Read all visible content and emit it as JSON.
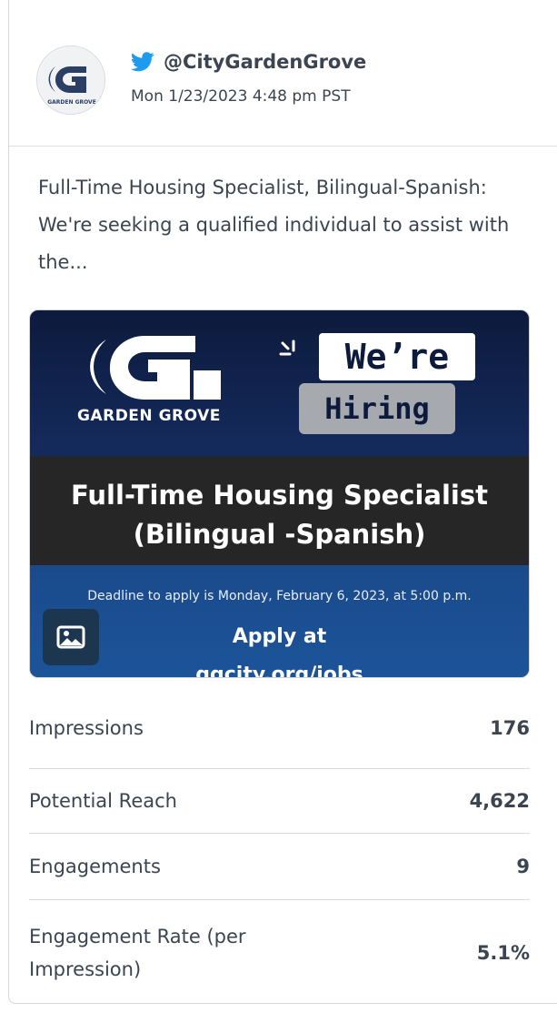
{
  "post": {
    "network_icon": "twitter-bird-icon",
    "brand_color": "#1d9bf0",
    "handle": "@CityGardenGrove",
    "timestamp": "Mon 1/23/2023 4:48 pm PST",
    "avatar_text": "Garden Grove",
    "text": "Full-Time Housing Specialist, Bilingual-Spanish: We're seeking a qualified individual to assist with the..."
  },
  "media": {
    "icon": "image-icon",
    "brand": "Garden Grove",
    "hiring_top": "We’re",
    "hiring_bottom": "Hiring",
    "title_line1": "Full-Time Housing Specialist",
    "title_line2": "(Bilingual -Spanish)",
    "deadline": "Deadline to apply is Monday, February 6, 2023, at 5:00 p.m.",
    "apply": "Apply at",
    "apply_url": "ggcity.org/jobs"
  },
  "stats": [
    {
      "label": "Impressions",
      "value": "176"
    },
    {
      "label": "Potential Reach",
      "value": "4,622"
    },
    {
      "label": "Engagements",
      "value": "9"
    },
    {
      "label": "Engagement Rate (per Impression)",
      "value": "5.1%"
    }
  ]
}
